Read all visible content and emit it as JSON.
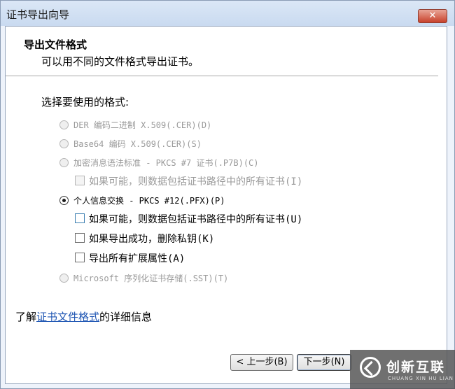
{
  "window": {
    "title": "证书导出向导",
    "close_label": "✕"
  },
  "header": {
    "title": "导出文件格式",
    "subtitle": "可以用不同的文件格式导出证书。"
  },
  "format_label": "选择要使用的格式:",
  "options": {
    "der": {
      "label": "DER 编码二进制 X.509(.CER)(D)",
      "selected": false,
      "enabled": false
    },
    "base64": {
      "label": "Base64 编码 X.509(.CER)(S)",
      "selected": false,
      "enabled": false
    },
    "pkcs7": {
      "label": "加密消息语法标准 - PKCS #7 证书(.P7B)(C)",
      "selected": false,
      "enabled": false
    },
    "pkcs7_include_chain": {
      "label": "如果可能，则数据包括证书路径中的所有证书(I)",
      "checked": false,
      "enabled": false
    },
    "pfx": {
      "label": "个人信息交换 - PKCS #12(.PFX)(P)",
      "selected": true,
      "enabled": true
    },
    "pfx_include_chain": {
      "label": "如果可能，则数据包括证书路径中的所有证书(U)",
      "checked": false,
      "enabled": true
    },
    "pfx_delete_key": {
      "label": "如果导出成功，删除私钥(K)",
      "checked": false,
      "enabled": true
    },
    "pfx_export_props": {
      "label": "导出所有扩展属性(A)",
      "checked": false,
      "enabled": true
    },
    "sst": {
      "label": "Microsoft 序列化证书存储(.SST)(T)",
      "selected": false,
      "enabled": false
    }
  },
  "footer": {
    "prefix": "了解",
    "link": "证书文件格式",
    "suffix": "的详细信息"
  },
  "buttons": {
    "back": "< 上一步(B)",
    "next": "下一步(N)"
  },
  "watermark": {
    "brand_cn": "创新互联",
    "brand_en": "CHUANG XIN HU LIAN"
  }
}
